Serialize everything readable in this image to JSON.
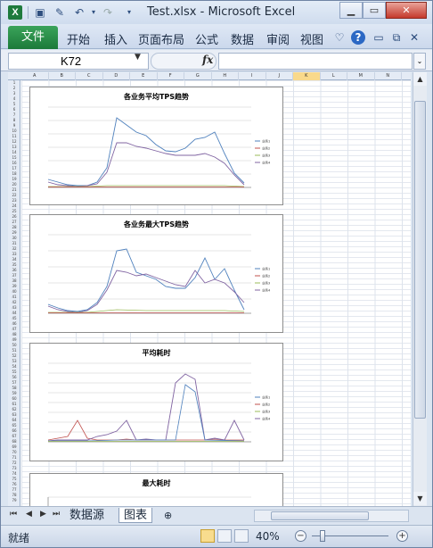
{
  "window": {
    "title": "Test.xlsx - Microsoft Excel",
    "app_icon": "X"
  },
  "ribbon": {
    "tabs": [
      "文件",
      "开始",
      "插入",
      "页面布局",
      "公式",
      "数据",
      "审阅",
      "视图"
    ]
  },
  "formula_bar": {
    "name_box": "K72",
    "fx": "fx",
    "formula": ""
  },
  "columns": [
    "A",
    "B",
    "C",
    "D",
    "E",
    "F",
    "G",
    "H",
    "I",
    "J",
    "K",
    "L",
    "M",
    "N",
    "O"
  ],
  "charts": [
    {
      "title": "各业务平均TPS趋势",
      "legend": [
        "业务1",
        "业务2",
        "业务3",
        "业务4"
      ]
    },
    {
      "title": "各业务最大TPS趋势",
      "legend": [
        "业务1",
        "业务2",
        "业务3",
        "业务4"
      ]
    },
    {
      "title": "平均耗时",
      "legend": [
        "业务1",
        "业务2",
        "业务3",
        "业务4"
      ]
    },
    {
      "title": "最大耗时",
      "legend": []
    }
  ],
  "sheets": {
    "tabs": [
      "数据源",
      "图表"
    ],
    "active": "图表"
  },
  "status": {
    "ready": "就绪",
    "zoom": "40%"
  },
  "colors": {
    "series1": "#4f81bd",
    "series2": "#c0504d",
    "series3": "#9bbb59",
    "series4": "#8064a2",
    "file_tab": "#1f7c3c"
  }
}
